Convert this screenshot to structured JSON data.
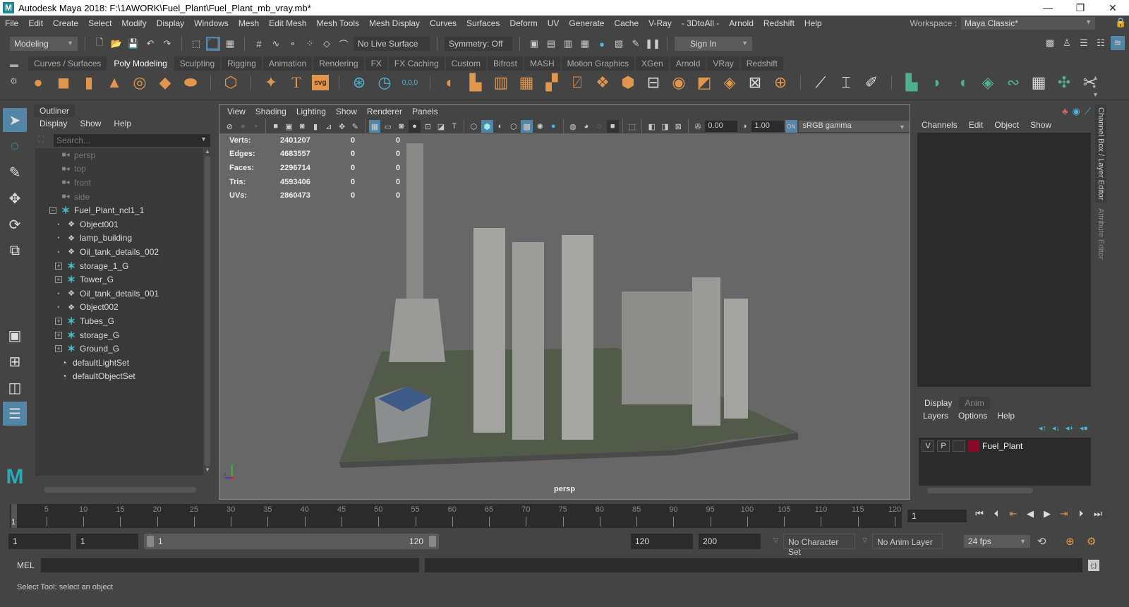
{
  "window": {
    "title": "Autodesk Maya 2018: F:\\1AWORK\\Fuel_Plant\\Fuel_Plant_mb_vray.mb*",
    "logo": "M",
    "minimize": "—",
    "maximize": "❐",
    "close": "✕"
  },
  "menubar": [
    "File",
    "Edit",
    "Create",
    "Select",
    "Modify",
    "Display",
    "Windows",
    "Mesh",
    "Edit Mesh",
    "Mesh Tools",
    "Mesh Display",
    "Curves",
    "Surfaces",
    "Deform",
    "UV",
    "Generate",
    "Cache",
    "V-Ray",
    "- 3DtoAll -",
    "Arnold",
    "Redshift",
    "Help"
  ],
  "workspace": {
    "label": "Workspace :",
    "value": "Maya Classic*"
  },
  "statusline": {
    "menuset": "Modeling",
    "live_surface": "No Live Surface",
    "symmetry": "Symmetry: Off",
    "sign_in": "Sign In"
  },
  "shelf": {
    "tabs": [
      "Curves / Surfaces",
      "Poly Modeling",
      "Sculpting",
      "Rigging",
      "Animation",
      "Rendering",
      "FX",
      "FX Caching",
      "Custom",
      "Bifrost",
      "MASH",
      "Motion Graphics",
      "XGen",
      "Arnold",
      "VRay",
      "Redshift"
    ],
    "active_tab": "Poly Modeling",
    "svg_label": "svg",
    "coord_label": "0,0,0"
  },
  "outliner": {
    "title": "Outliner",
    "menu": [
      "Display",
      "Show",
      "Help"
    ],
    "search_placeholder": "Search...",
    "items": [
      {
        "label": "persp",
        "type": "camera",
        "dim": true,
        "depth": 0
      },
      {
        "label": "top",
        "type": "camera",
        "dim": true,
        "depth": 0
      },
      {
        "label": "front",
        "type": "camera",
        "dim": true,
        "depth": 0
      },
      {
        "label": "side",
        "type": "camera",
        "dim": true,
        "depth": 0
      },
      {
        "label": "Fuel_Plant_ncl1_1",
        "type": "group",
        "expanded": true,
        "depth": 0
      },
      {
        "label": "Object001",
        "type": "mesh",
        "depth": 1
      },
      {
        "label": "lamp_building",
        "type": "mesh",
        "depth": 1
      },
      {
        "label": "Oil_tank_details_002",
        "type": "mesh",
        "depth": 1
      },
      {
        "label": "storage_1_G",
        "type": "group",
        "expanded": false,
        "depth": 1
      },
      {
        "label": "Tower_G",
        "type": "group",
        "expanded": false,
        "depth": 1
      },
      {
        "label": "Oil_tank_details_001",
        "type": "mesh",
        "depth": 1
      },
      {
        "label": "Object002",
        "type": "mesh",
        "depth": 1
      },
      {
        "label": "Tubes_G",
        "type": "group",
        "expanded": false,
        "depth": 1
      },
      {
        "label": "storage_G",
        "type": "group",
        "expanded": false,
        "depth": 1
      },
      {
        "label": "Ground_G",
        "type": "group",
        "expanded": false,
        "depth": 1
      },
      {
        "label": "defaultLightSet",
        "type": "set",
        "depth": 0
      },
      {
        "label": "defaultObjectSet",
        "type": "set",
        "depth": 0
      }
    ]
  },
  "viewport": {
    "menu": [
      "View",
      "Shading",
      "Lighting",
      "Show",
      "Renderer",
      "Panels"
    ],
    "exposure": "0.00",
    "gamma": "1.00",
    "color_mgmt": "sRGB gamma",
    "hud": [
      {
        "label": "Verts:",
        "value": "2401207",
        "a": "0",
        "b": "0"
      },
      {
        "label": "Edges:",
        "value": "4683557",
        "a": "0",
        "b": "0"
      },
      {
        "label": "Faces:",
        "value": "2296714",
        "a": "0",
        "b": "0"
      },
      {
        "label": "Tris:",
        "value": "4593406",
        "a": "0",
        "b": "0"
      },
      {
        "label": "UVs:",
        "value": "2860473",
        "a": "0",
        "b": "0"
      }
    ],
    "camera": "persp"
  },
  "channelbox": {
    "menu": [
      "Channels",
      "Edit",
      "Object",
      "Show"
    ],
    "side_tabs": [
      "Channel Box / Layer Editor",
      "Attribute Editor"
    ]
  },
  "layer_editor": {
    "tabs": [
      "Display",
      "Anim"
    ],
    "active_tab": "Display",
    "menu": [
      "Layers",
      "Options",
      "Help"
    ],
    "layers": [
      {
        "v": "V",
        "p": "P",
        "name": "Fuel_Plant",
        "color": "#8b0a2a"
      }
    ]
  },
  "timeline": {
    "ticks": [
      5,
      10,
      15,
      20,
      25,
      30,
      35,
      40,
      45,
      50,
      55,
      60,
      65,
      70,
      75,
      80,
      85,
      90,
      95,
      100,
      105,
      110,
      115,
      120
    ],
    "current_frame": "1",
    "current_field": "1"
  },
  "range": {
    "start": "1",
    "playback_start": "1",
    "slider_start": "1",
    "slider_end": "120",
    "playback_end": "120",
    "end": "200",
    "character_set": "No Character Set",
    "anim_layer": "No Anim Layer",
    "fps": "24 fps"
  },
  "command_line": {
    "label": "MEL"
  },
  "help_line": "Select Tool: select an object"
}
